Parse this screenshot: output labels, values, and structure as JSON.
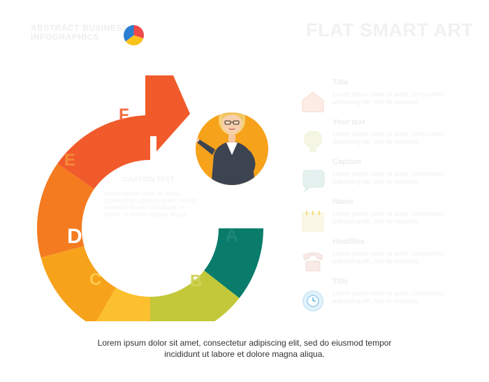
{
  "header": {
    "brand_line1": "ABSTRACT BUSINESS",
    "brand_line2": "INFOGRAPHICS",
    "title": "FLAT SMART ART"
  },
  "cycle": {
    "segments": [
      {
        "label": "F",
        "color": "#f15a2a"
      },
      {
        "label": "E",
        "color": "#f47b20"
      },
      {
        "label": "D",
        "color": "#f7a21b"
      },
      {
        "label": "C",
        "color": "#fcc02e"
      },
      {
        "label": "B",
        "color": "#c3c83a"
      },
      {
        "label": "A",
        "color": "#0a7c6b"
      }
    ],
    "center_title": "CAPTION TEXT",
    "center_text": "Lorem ipsum dolor sit amet, consectetur adipiscing elit, sed do eiusmod tempor incididunt ut labore et dolore magna aliqua."
  },
  "legend": [
    {
      "title": "Title",
      "text": "Lorem ipsum dolor sit amet, consectetur adipiscing elit, sed do eiusmod.",
      "icon": "home-icon",
      "color": "#f15a2a"
    },
    {
      "title": "Your text",
      "text": "Lorem ipsum dolor sit amet, consectetur adipiscing elit, sed do eiusmod.",
      "icon": "bulb-icon",
      "color": "#c3c83a"
    },
    {
      "title": "Caption",
      "text": "Lorem ipsum dolor sit amet, consectetur adipiscing elit, sed do eiusmod.",
      "icon": "chat-icon",
      "color": "#0a7c6b"
    },
    {
      "title": "Name",
      "text": "Lorem ipsum dolor sit amet, consectetur adipiscing elit, sed do eiusmod.",
      "icon": "calendar-icon",
      "color": "#fcc02e"
    },
    {
      "title": "Headline",
      "text": "Lorem ipsum dolor sit amet, consectetur adipiscing elit, sed do eiusmod.",
      "icon": "phone-icon",
      "color": "#f47b20"
    },
    {
      "title": "Title",
      "text": "Lorem ipsum dolor sit amet, consectetur adipiscing elit, sed do eiusmod.",
      "icon": "clock-icon",
      "color": "#29a9e0"
    }
  ],
  "footer": {
    "line1": "Lorem ipsum dolor sit amet, consectetur adipiscing elit, sed do eiusmod tempor",
    "line2": "incididunt ut labore et dolore magna aliqua."
  }
}
